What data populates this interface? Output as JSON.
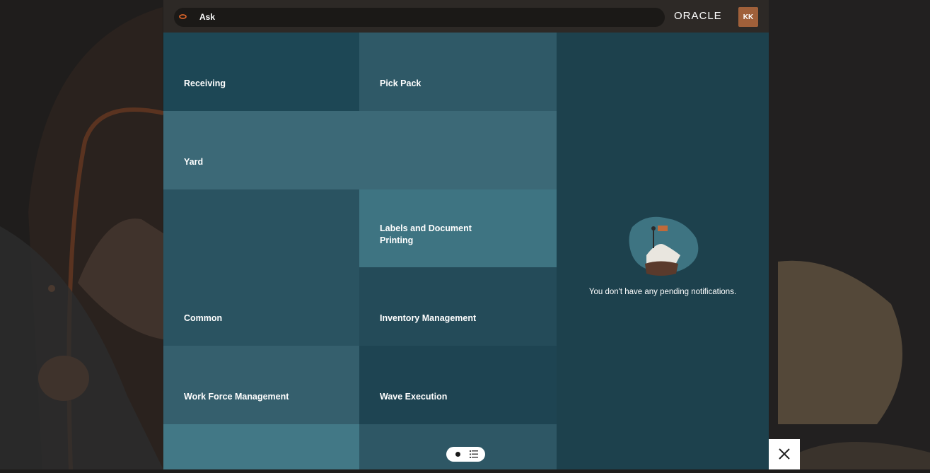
{
  "header": {
    "search_label": "Ask",
    "brand": "ORACLE",
    "user_initials": "KK"
  },
  "tiles": [
    {
      "label": "Receiving"
    },
    {
      "label": "Pick Pack"
    },
    {
      "label": "Yard"
    },
    {
      "label": "Labels and Document Printing"
    },
    {
      "label": "Common"
    },
    {
      "label": "Inventory Management"
    },
    {
      "label": "Work Force Management"
    },
    {
      "label": "Wave Execution"
    }
  ],
  "notifications": {
    "empty_message": "You don't have any pending notifications."
  },
  "icons": {
    "search": "oval-search-icon",
    "close": "close-icon",
    "grid_view": "dot-icon",
    "list_view": "list-icon"
  },
  "colors": {
    "accent": "#e2672a",
    "avatar_bg": "#a0603a",
    "panel_bg": "#1d414d"
  }
}
